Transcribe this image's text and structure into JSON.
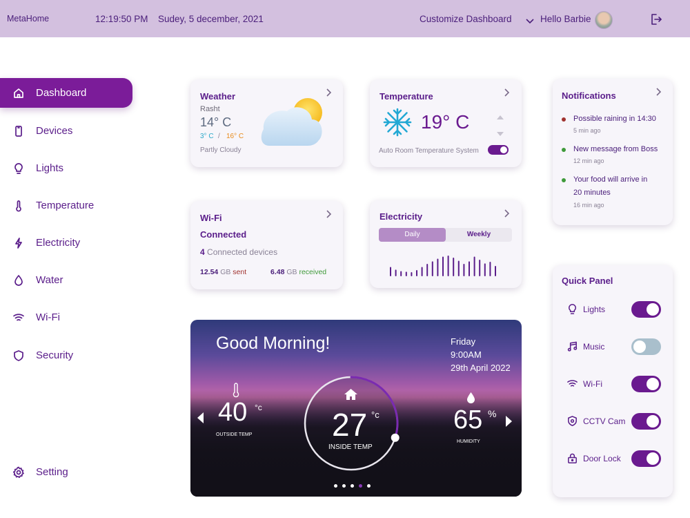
{
  "topbar": {
    "brand": "MetaHome",
    "time": "12:19:50 PM",
    "date": "Sudey, 5 december, 2021",
    "customize": "Customize Dashboard",
    "greeting": "Hello Barbie"
  },
  "sidebar": {
    "items": [
      {
        "label": "Dashboard",
        "icon": "home-icon"
      },
      {
        "label": "Devices",
        "icon": "phone-icon"
      },
      {
        "label": "Lights",
        "icon": "bulb-icon"
      },
      {
        "label": "Temperature",
        "icon": "thermometer-icon"
      },
      {
        "label": "Electricity",
        "icon": "bolt-icon"
      },
      {
        "label": "Water",
        "icon": "drop-icon"
      },
      {
        "label": "Wi-Fi",
        "icon": "wifi-icon"
      },
      {
        "label": "Security",
        "icon": "shield-icon"
      }
    ],
    "setting": "Setting"
  },
  "weather": {
    "title": "Weather",
    "city": "Rasht",
    "temp": "14° C",
    "low": "3° C",
    "sep": "/",
    "high": "16° C",
    "condition": "Partly Cloudy"
  },
  "temperature": {
    "title": "Temperature",
    "value": "19° C",
    "auto": "Auto Room Temperature System",
    "auto_on": true
  },
  "wifi": {
    "title": "Wi-Fi",
    "status": "Connected",
    "devices_count": "4",
    "devices_label": "Connected devices",
    "sent_value": "12.54",
    "sent_unit": "GB",
    "sent_label": "sent",
    "recv_value": "6.48",
    "recv_unit": "GB",
    "recv_label": "received"
  },
  "electricity": {
    "title": "Electricity",
    "tabs": [
      "Daily",
      "Weekly"
    ],
    "active_tab": "Daily",
    "bars": [
      0.45,
      0.32,
      0.25,
      0.22,
      0.2,
      0.3,
      0.45,
      0.6,
      0.72,
      0.85,
      0.95,
      1.0,
      0.9,
      0.75,
      0.6,
      0.72,
      0.95,
      0.8,
      0.62,
      0.7,
      0.5
    ]
  },
  "notifications": {
    "title": "Notifications",
    "items": [
      {
        "text": "Possible raining in 14:30",
        "time": "5 min ago",
        "color": "#a0322e"
      },
      {
        "text": "New message from Boss",
        "time": "12 min ago",
        "color": "#3f9a3a"
      },
      {
        "text": "Your food will arrive in",
        "text2": "20 minutes",
        "time": "16 min ago",
        "color": "#3f9a3a"
      }
    ]
  },
  "quick_panel": {
    "title": "Quick Panel",
    "items": [
      {
        "label": "Lights",
        "icon": "bulb-icon",
        "on": true
      },
      {
        "label": "Music",
        "icon": "music-icon",
        "on": false
      },
      {
        "label": "Wi-Fi",
        "icon": "wifi-icon",
        "on": true
      },
      {
        "label": "CCTV Cam",
        "icon": "shield-icon",
        "on": true
      },
      {
        "label": "Door Lock",
        "icon": "lock-icon",
        "on": true
      }
    ]
  },
  "hero": {
    "greeting": "Good Morning!",
    "day": "Friday",
    "time": "9:00AM",
    "date": "29th April 2022",
    "outside_temp": "40",
    "outside_unit": "°c",
    "outside_label": "OUTSIDE TEMP",
    "inside_temp": "27",
    "inside_unit": "°c",
    "inside_label": "INSIDE TEMP",
    "humidity": "65",
    "humidity_unit": "%",
    "humidity_label": "HUMIDITY",
    "inside_progress": 0.3,
    "pages": 5,
    "active_page": 3
  }
}
